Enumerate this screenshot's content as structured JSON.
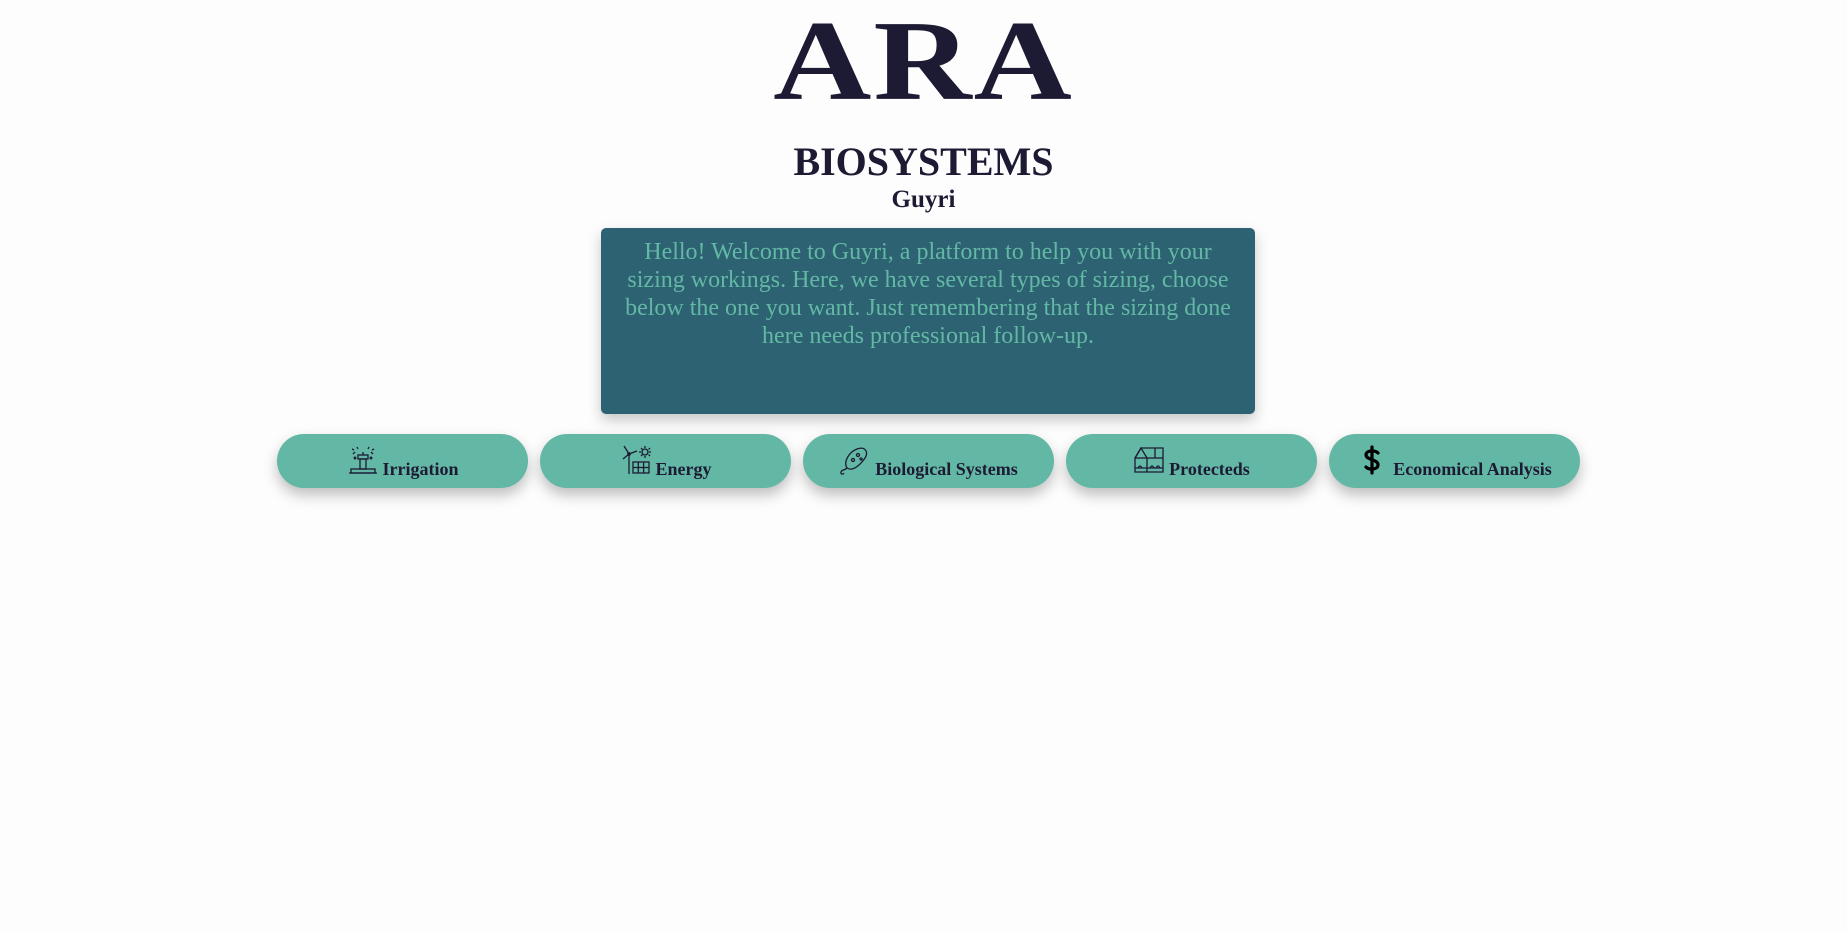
{
  "header": {
    "logo_text": "ARA",
    "subtitle": "BIOSYSTEMS",
    "app_name": "Guyri"
  },
  "welcome": {
    "message": "Hello! Welcome to Guyri, a platform to help you with your sizing workings. Here, we have several types of sizing, choose below the one you want. Just remembering that the sizing done here needs professional follow-up."
  },
  "nav": {
    "items": [
      {
        "label": "Irrigation",
        "icon": "sprinkler-icon"
      },
      {
        "label": "Energy",
        "icon": "wind-solar-icon"
      },
      {
        "label": "Biological Systems",
        "icon": "bacteria-icon"
      },
      {
        "label": "Protecteds",
        "icon": "greenhouse-icon"
      },
      {
        "label": "Economical Analysis",
        "icon": "dollar-icon"
      }
    ]
  },
  "colors": {
    "dark_text": "#1d1a34",
    "welcome_bg": "#2d6272",
    "accent_teal": "#63b8a5",
    "page_bg": "#fdfdfd"
  }
}
